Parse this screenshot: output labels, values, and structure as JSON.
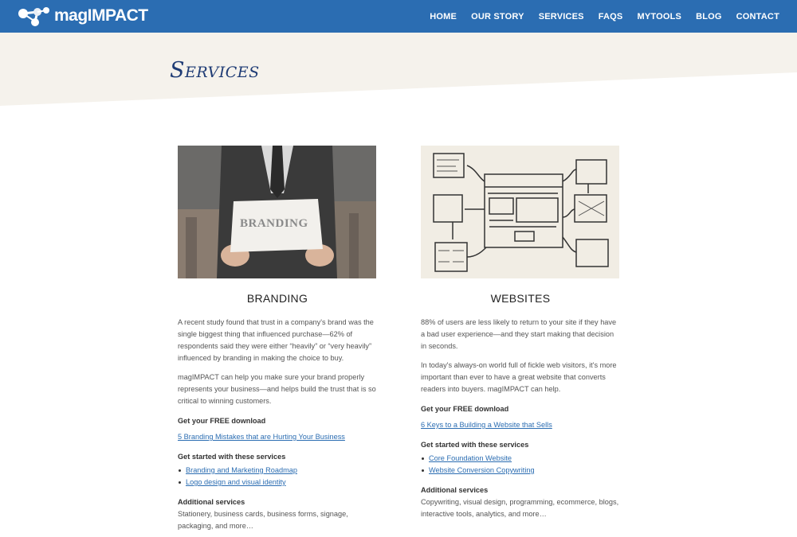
{
  "header": {
    "brand": "magIMPACT",
    "nav": [
      "HOME",
      "OUR STORY",
      "SERVICES",
      "FAQS",
      "MYTOOLS",
      "BLOG",
      "CONTACT"
    ]
  },
  "page": {
    "title": "Services"
  },
  "colors": {
    "topbar": "#2b6db2",
    "hero": "#f5f2ec",
    "title": "#1f3c75",
    "link": "#2b6db2"
  },
  "branding": {
    "image_text": "BRANDING",
    "heading": "BRANDING",
    "intro": "A recent study found that trust in a company's brand was the single biggest thing that influenced purchase—62% of respondents said they were either “heavily” or “very heavily” influenced by branding in making the choice to buy.",
    "para2": "magIMPACT can help you make sure your brand properly represents your business—and helps build the trust that is so critical to winning customers.",
    "download_heading": "Get your FREE download",
    "download_link": "5 Branding Mistakes that are Hurting Your Business",
    "services_heading": "Get started with these services",
    "services": [
      "Branding and Marketing Roadmap",
      "Logo design and visual identity"
    ],
    "additional_heading": "Additional services",
    "additional_text": "Stationery, business cards, business forms, signage, packaging, and more…"
  },
  "websites": {
    "heading": "WEBSITES",
    "intro": "88% of users are less likely to return to your site if they have a bad user experience—and they start making that decision in seconds.",
    "para2": "In today's always-on world full of fickle web visitors, it's more important than ever to have a great website that converts readers into buyers. magIMPACT can help.",
    "download_heading": "Get your FREE download",
    "download_link": "6 Keys to a Building a Website that Sells",
    "services_heading": "Get started with these services",
    "services": [
      "Core Foundation Website",
      "Website Conversion Copywriting"
    ],
    "additional_heading": "Additional services",
    "additional_text": "Copywriting, visual design, programming, ecommerce, blogs, interactive tools, analytics, and more…"
  }
}
